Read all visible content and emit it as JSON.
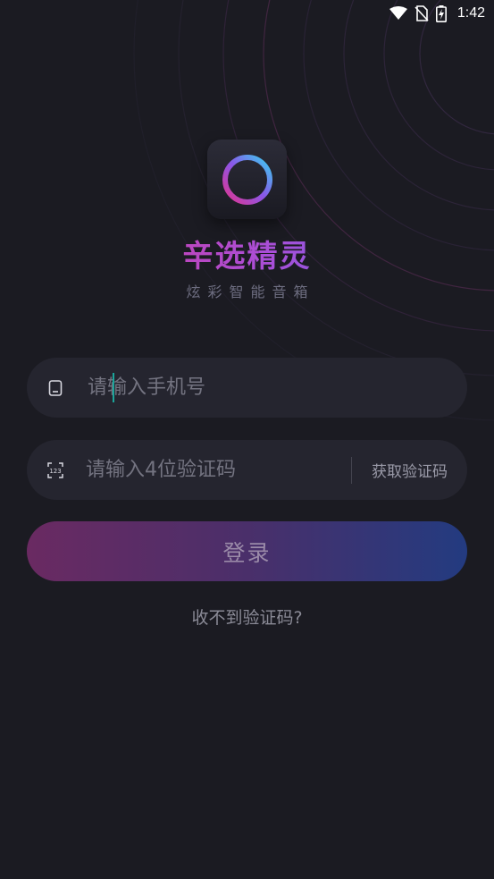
{
  "status_bar": {
    "time": "1:42",
    "icons": [
      "wifi-icon",
      "no-sim-icon",
      "battery-charging-icon"
    ]
  },
  "app": {
    "logo_icon": "ring-logo-icon",
    "title": "辛选精灵",
    "subtitle": "炫彩智能音箱"
  },
  "form": {
    "phone": {
      "icon": "phone-icon",
      "placeholder": "请输入手机号",
      "value": ""
    },
    "code": {
      "icon": "numeric-keypad-icon",
      "placeholder": "请输入4位验证码",
      "value": "",
      "get_code_label": "获取验证码"
    },
    "login_label": "登录",
    "help_label": "收不到验证码?"
  },
  "colors": {
    "background": "#1b1b22",
    "field_background": "#25252f",
    "title_gradient_start": "#e0358f",
    "title_gradient_end": "#4f6bf0",
    "button_gradient_start": "#6a2a62",
    "button_gradient_end": "#233b80",
    "cursor": "#1ba59a"
  }
}
